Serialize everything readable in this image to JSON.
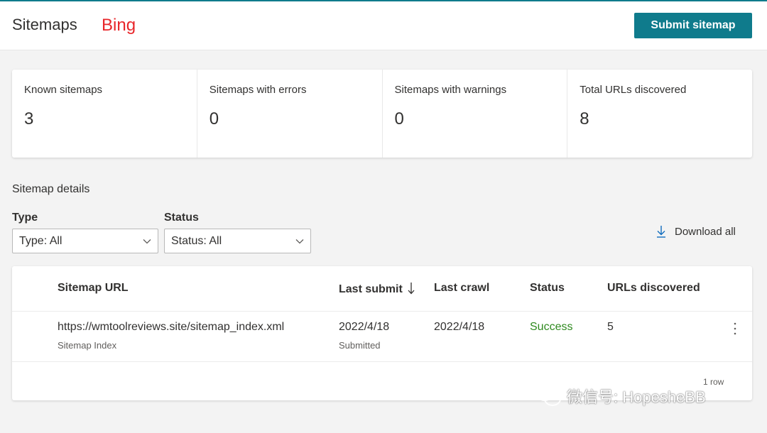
{
  "header": {
    "title": "Sitemaps",
    "engine_tag": "Bing",
    "submit_label": "Submit sitemap",
    "accent_color": "#0f7b8c",
    "engine_tag_color": "#e8262a"
  },
  "stats": [
    {
      "label": "Known sitemaps",
      "value": "3"
    },
    {
      "label": "Sitemaps with errors",
      "value": "0"
    },
    {
      "label": "Sitemaps with warnings",
      "value": "0"
    },
    {
      "label": "Total URLs discovered",
      "value": "8"
    }
  ],
  "details": {
    "title": "Sitemap details",
    "filters": {
      "type": {
        "label": "Type",
        "value": "Type: All",
        "icon": "chevron-down-icon"
      },
      "status": {
        "label": "Status",
        "value": "Status: All",
        "icon": "chevron-down-icon"
      }
    },
    "download_label": "Download all",
    "download_icon": "download-icon"
  },
  "table": {
    "columns": [
      "Sitemap URL",
      "Last submit",
      "Last crawl",
      "Status",
      "URLs discovered"
    ],
    "sort_icon": "arrow-down-icon",
    "rows": [
      {
        "url": "https://wmtoolreviews.site/sitemap_index.xml",
        "type": "Sitemap Index",
        "last_submit": "2022/4/18",
        "submit_note": "Submitted",
        "last_crawl": "2022/4/18",
        "status": "Success",
        "status_color": "#2f8a1f",
        "urls_discovered": "5"
      }
    ],
    "row_count": "1 row"
  },
  "watermark": {
    "text": "微信号: HopesheBB",
    "icon": "wechat-icon"
  }
}
